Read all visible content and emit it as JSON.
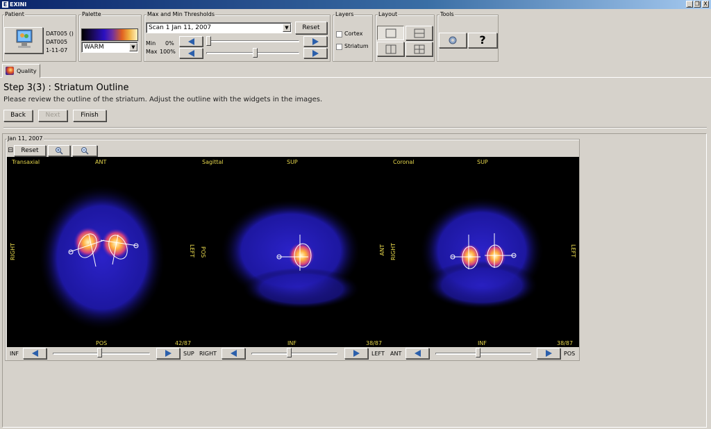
{
  "window": {
    "title": "EXINI",
    "logo_letter": "E",
    "minimize": "_",
    "restore": "❐",
    "close": "X"
  },
  "patient": {
    "group_label": "Patient",
    "icon": "patient-monitor-icon",
    "lines": [
      "DAT005 ()",
      "DAT005",
      "1-11-07"
    ]
  },
  "palette": {
    "group_label": "Palette",
    "selected": "WARM"
  },
  "thresholds": {
    "group_label": "Max and Min Thresholds",
    "scan_selected": "Scan 1 Jan 11, 2007",
    "reset_label": "Reset",
    "min_label": "Min",
    "min_value": "0%",
    "max_label": "Max",
    "max_value": "100%",
    "min_fraction": 0.0,
    "max_fraction": 0.53
  },
  "layers": {
    "group_label": "Layers",
    "items": [
      {
        "label": "Cortex",
        "checked": false
      },
      {
        "label": "Striatum",
        "checked": false
      }
    ]
  },
  "layout": {
    "group_label": "Layout"
  },
  "tools": {
    "group_label": "Tools",
    "help_label": "?"
  },
  "tabs": [
    {
      "label": "Quality",
      "icon": "quality-icon"
    }
  ],
  "step": {
    "title": "Step 3(3) : Striatum Outline",
    "description": "Please review the outline of the striatum. Adjust the outline with the widgets in the images.",
    "back": "Back",
    "next": "Next",
    "finish": "Finish"
  },
  "viewer": {
    "date": "Jan 11, 2007",
    "collapse": "⊟",
    "reset": "Reset",
    "views": [
      {
        "name": "Transaxial",
        "top": "ANT",
        "bottom": "POS",
        "left": "RIGHT",
        "right": "LEFT",
        "counter": "42/87",
        "ctrl_left": "INF",
        "ctrl_right": "SUP",
        "slice_fraction": 0.48
      },
      {
        "name": "Sagittal",
        "top": "SUP",
        "bottom": "INF",
        "left": "POS",
        "right": "ANT",
        "counter": "38/87",
        "ctrl_left": "RIGHT",
        "ctrl_right": "LEFT",
        "slice_fraction": 0.44
      },
      {
        "name": "Coronal",
        "top": "SUP",
        "bottom": "INF",
        "left": "RIGHT",
        "right": "LEFT",
        "counter": "38/87",
        "ctrl_left": "ANT",
        "ctrl_right": "POS",
        "slice_fraction": 0.44
      }
    ]
  }
}
